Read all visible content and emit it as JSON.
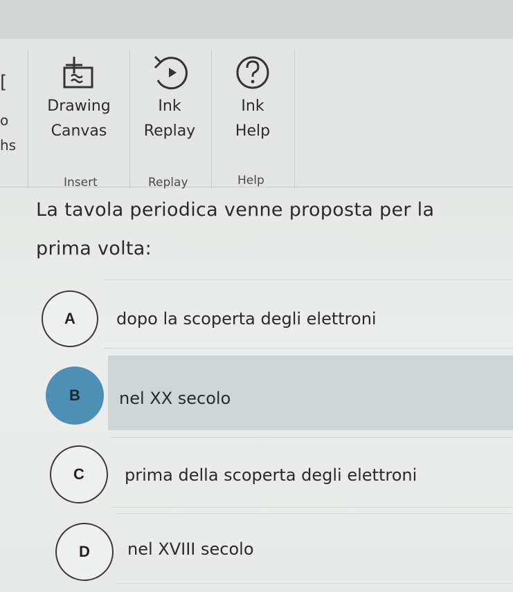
{
  "ribbon": {
    "cutoff_left": [
      "o",
      "hs"
    ],
    "buttons": [
      {
        "id": "drawing-canvas",
        "label_line1": "Drawing",
        "label_line2": "Canvas"
      },
      {
        "id": "ink-replay",
        "label_line1": "Ink",
        "label_line2": "Replay"
      },
      {
        "id": "ink-help",
        "label_line1": "Ink",
        "label_line2": "Help"
      }
    ],
    "groups": [
      "Insert",
      "Replay",
      "Help"
    ],
    "icons": [
      "drawing-canvas-icon",
      "ink-replay-icon",
      "help-icon"
    ]
  },
  "question": {
    "line1": "La tavola periodica venne proposta per la",
    "line2": "prima volta:"
  },
  "options": [
    {
      "letter": "A",
      "text": "dopo la scoperta degli elettroni",
      "selected": false
    },
    {
      "letter": "B",
      "text": "nel XX secolo",
      "selected": true
    },
    {
      "letter": "C",
      "text": "prima della scoperta degli elettroni",
      "selected": false
    },
    {
      "letter": "D",
      "text": "nel XVIII secolo",
      "selected": false
    }
  ],
  "colors": {
    "selected_circle": "#4e8fb6",
    "selected_row": "#cfd6d8",
    "background": "#eceeed"
  }
}
